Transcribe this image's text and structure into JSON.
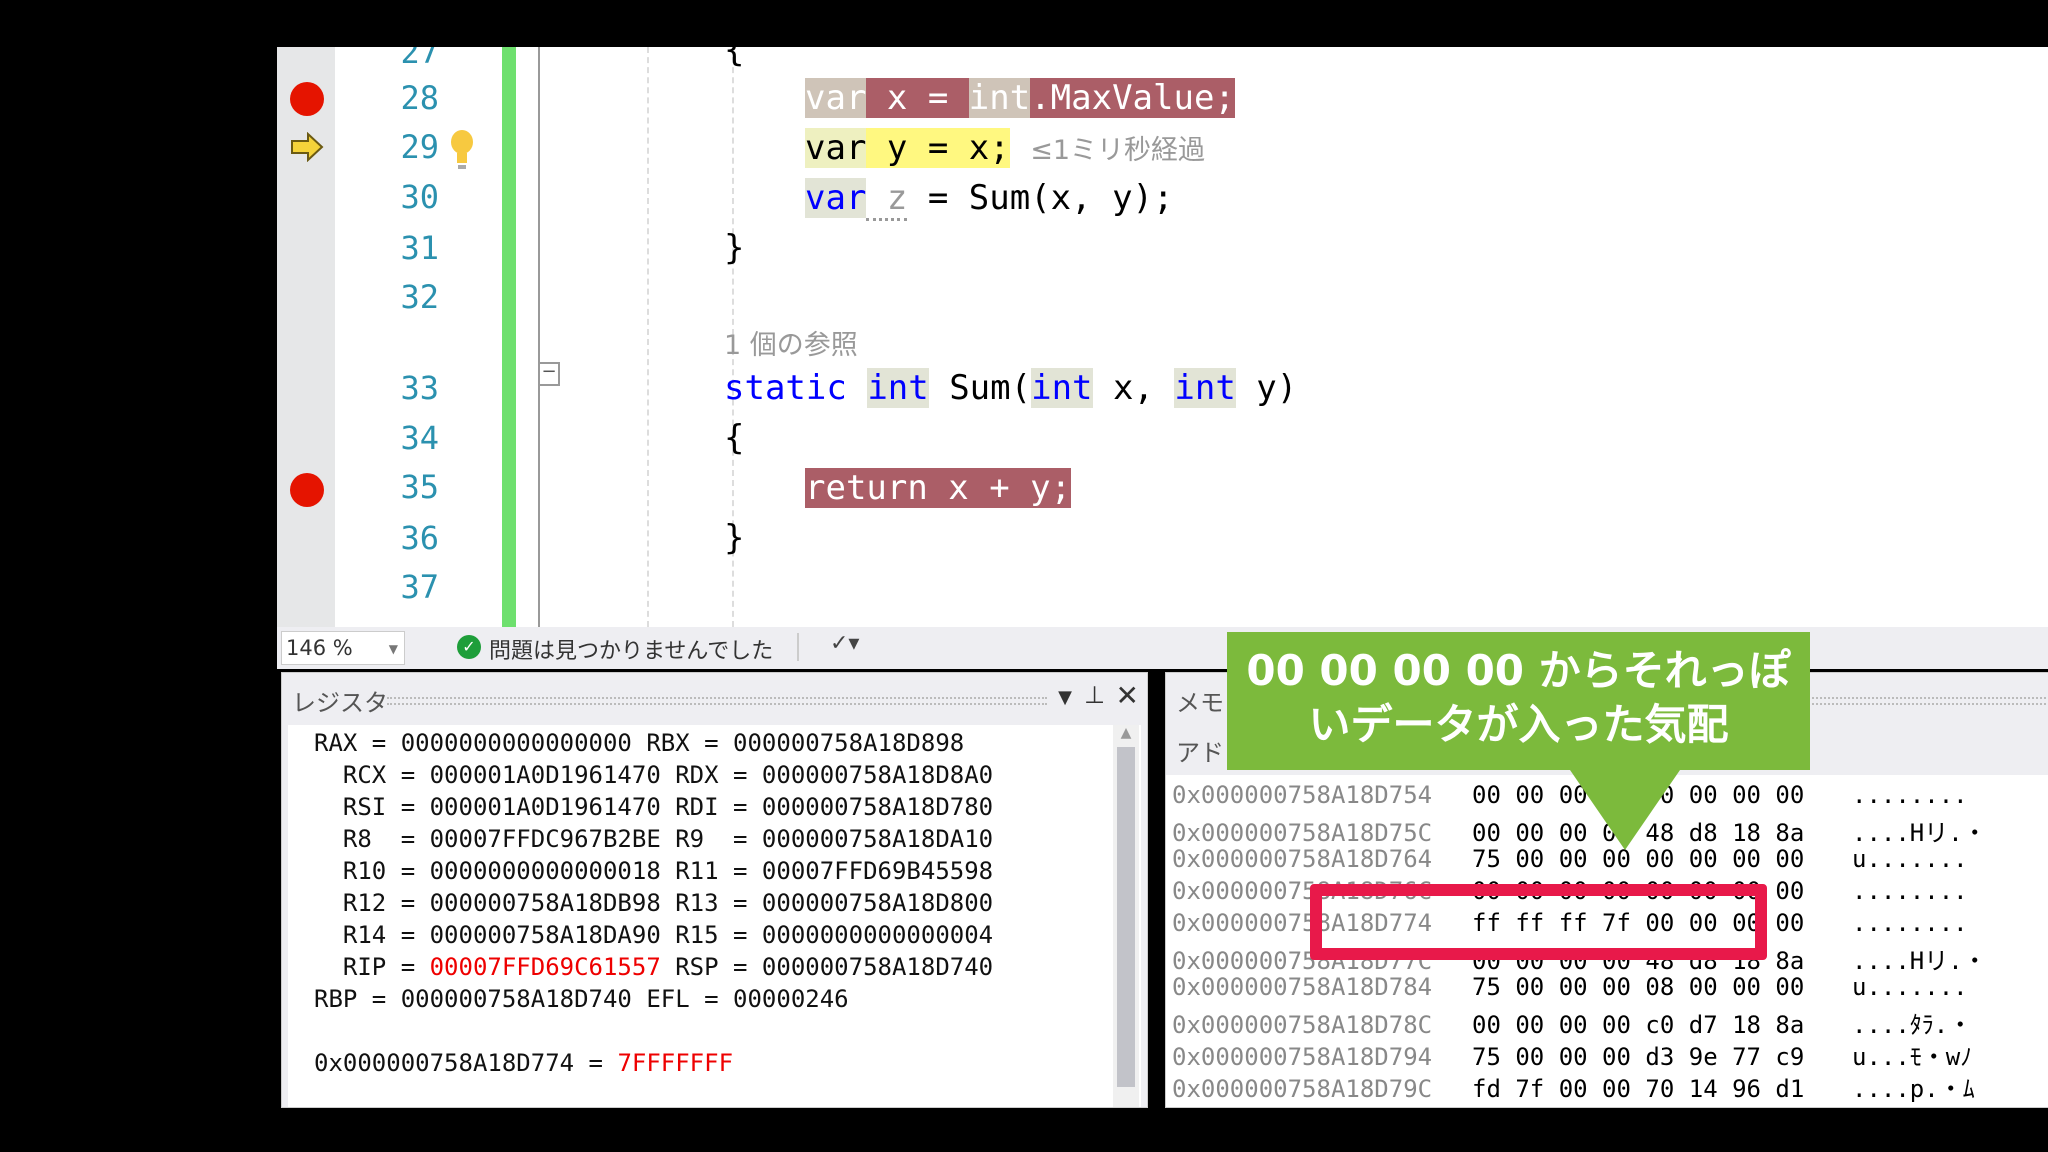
{
  "editor": {
    "line_numbers": [
      "27",
      "28",
      "29",
      "30",
      "31",
      "32",
      "33",
      "34",
      "35",
      "36",
      "37"
    ],
    "breakpoint_lines": [
      "28",
      "35"
    ],
    "current_line": "29",
    "lines": {
      "l27": "{",
      "l28": {
        "a": "var",
        "b": " x = ",
        "c": "int",
        "d": ".MaxValue;"
      },
      "l29": {
        "a": "var",
        "b": " y = x;",
        "perf": "≤1ミリ秒経過"
      },
      "l30": {
        "a": "var",
        "b": " z",
        "c": " = Sum(x, y);"
      },
      "l31": "}",
      "codelens": "1 個の参照",
      "l33": {
        "a": "static",
        "b": "int",
        "c": " Sum(",
        "d": "int",
        "e": " x, ",
        "f": "int",
        "g": " y)"
      },
      "l34": "{",
      "l35": "return x + y;",
      "l36": "}"
    }
  },
  "status": {
    "zoom": "146 %",
    "issues": "問題は見つかりませんでした"
  },
  "registers": {
    "title": "レジスタ",
    "lines": [
      "RAX = 0000000000000000 RBX = 000000758A18D898",
      "  RCX = 000001A0D1961470 RDX = 000000758A18D8A0",
      "  RSI = 000001A0D1961470 RDI = 000000758A18D780",
      "  R8  = 00007FFDC967B2BE R9  = 000000758A18DA10",
      "  R10 = 0000000000000018 R11 = 00007FFD69B45598",
      "  R12 = 000000758A18DB98 R13 = 000000758A18D800",
      "  R14 = 000000758A18DA90 R15 = 0000000000000004"
    ],
    "rip_label": "  RIP = ",
    "rip_value": "00007FFD69C61557",
    "rsp": " RSP = 000000758A18D740",
    "rbp_line": "RBP = 000000758A18D740 EFL = 00000246",
    "watch_addr": "0x000000758A18D774 = ",
    "watch_value": "7FFFFFFF"
  },
  "memory": {
    "title": "メモリ",
    "address_label": "アドレ",
    "rows": [
      {
        "addr": "0x000000758A18D754",
        "bytes": "00 00 00 00 00 00 00 00",
        "ascii": "........"
      },
      {
        "addr": "0x000000758A18D75C",
        "bytes": "00 00 00 00 48 d8 18 8a",
        "ascii": "....Hリ.・"
      },
      {
        "addr": "0x000000758A18D764",
        "bytes": "75 00 00 00 00 00 00 00",
        "ascii": "u......."
      },
      {
        "addr": "0x000000758A18D76C",
        "bytes": "00 00 00 00 00 00 00 00",
        "ascii": "........"
      },
      {
        "addr": "0x000000758A18D774",
        "bytes": "ff ff ff 7f 00 00 00 00",
        "ascii": "........"
      },
      {
        "addr": "0x000000758A18D77C",
        "bytes": "00 00 00 00 48 d8 18 8a",
        "ascii": "....Hリ.・"
      },
      {
        "addr": "0x000000758A18D784",
        "bytes": "75 00 00 00 08 00 00 00",
        "ascii": "u......."
      },
      {
        "addr": "0x000000758A18D78C",
        "bytes": "00 00 00 00 c0 d7 18 8a",
        "ascii": "....ﾀﾗ.・"
      },
      {
        "addr": "0x000000758A18D794",
        "bytes": "75 00 00 00 d3 9e 77 c9",
        "ascii": "u...ﾓ・wﾉ"
      },
      {
        "addr": "0x000000758A18D79C",
        "bytes": "fd 7f 00 00 70 14 96 d1",
        "ascii": "....p.・ﾑ"
      }
    ]
  },
  "callout": {
    "line1": "00 00 00 00 からそれっぽ",
    "line2": "いデータが入った気配"
  },
  "colors": {
    "breakpoint": "#e51400",
    "callout": "#7cba3c",
    "highlight_box": "#e8194a",
    "line_number": "#2b91af"
  }
}
